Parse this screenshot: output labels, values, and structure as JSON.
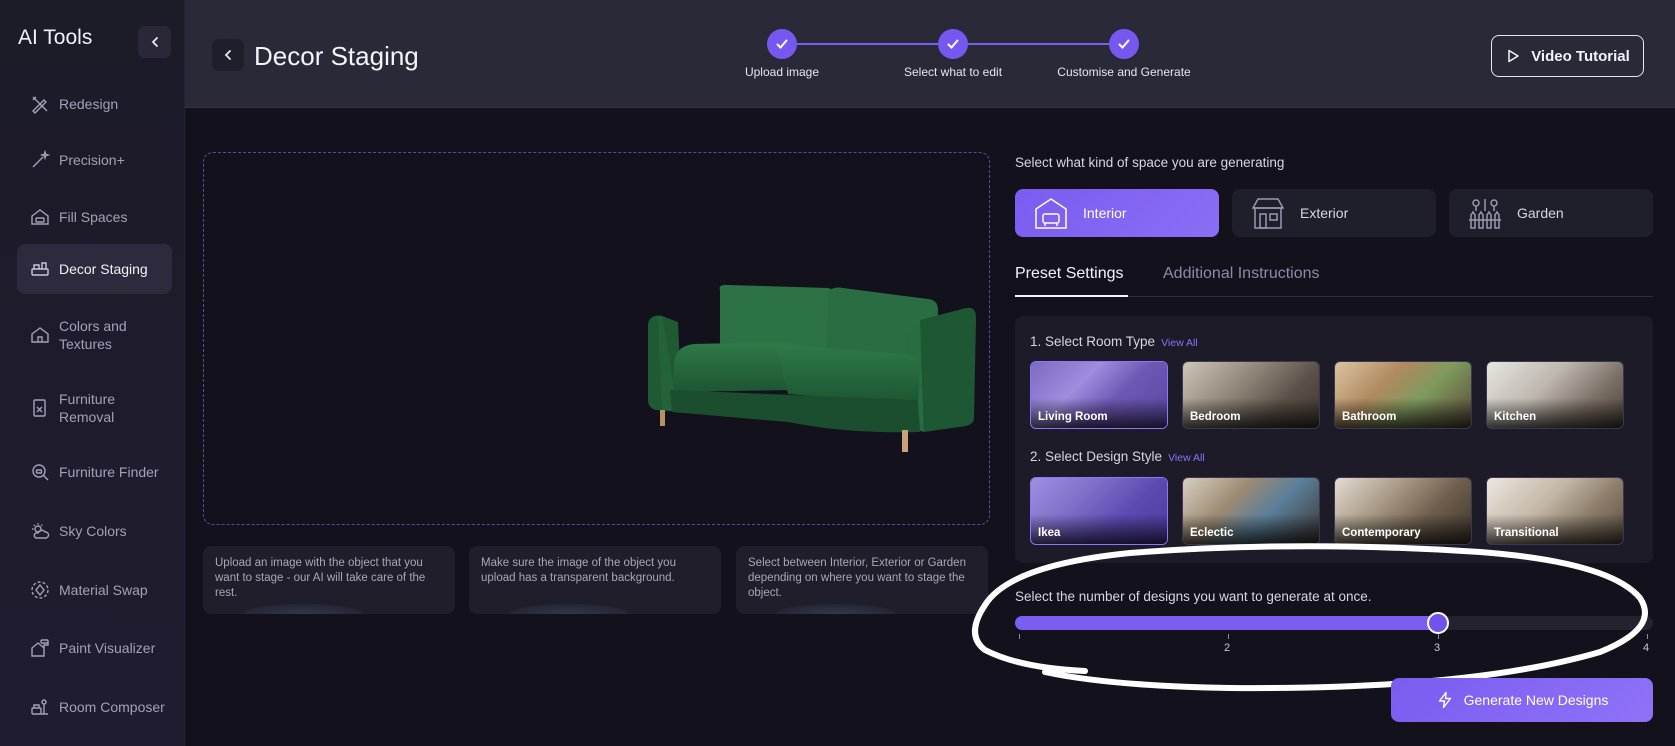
{
  "sidebar": {
    "title": "AI Tools",
    "items": [
      {
        "label": "Redesign",
        "icon": "pencil-ruler-icon"
      },
      {
        "label": "Precision+",
        "icon": "magic-wand-icon"
      },
      {
        "label": "Fill Spaces",
        "icon": "house-sofa-icon"
      },
      {
        "label": "Decor Staging",
        "icon": "staging-icon",
        "active": true
      },
      {
        "label": "Colors and Textures",
        "icon": "house-paint-icon"
      },
      {
        "label": "Furniture Removal",
        "icon": "removal-icon"
      },
      {
        "label": "Furniture Finder",
        "icon": "search-furniture-icon"
      },
      {
        "label": "Sky Colors",
        "icon": "sun-cloud-icon"
      },
      {
        "label": "Material Swap",
        "icon": "swap-circle-icon"
      },
      {
        "label": "Paint Visualizer",
        "icon": "paint-roller-icon"
      },
      {
        "label": "Room Composer",
        "icon": "composer-icon"
      }
    ]
  },
  "header": {
    "title": "Decor Staging",
    "steps": [
      {
        "label": "Upload image",
        "done": true
      },
      {
        "label": "Select what to edit",
        "done": true
      },
      {
        "label": "Customise and Generate",
        "done": true
      }
    ],
    "tutorial_label": "Video Tutorial"
  },
  "tips": [
    "Upload an image with the object that you want to stage - our AI will take care of the rest.",
    "Make sure the image of the object you upload has a transparent background.",
    "Select between Interior, Exterior or Garden depending on where you want to stage the object."
  ],
  "space": {
    "label": "Select what kind of space you are generating",
    "options": [
      {
        "label": "Interior",
        "selected": true
      },
      {
        "label": "Exterior",
        "selected": false
      },
      {
        "label": "Garden",
        "selected": false
      }
    ]
  },
  "tabs": [
    {
      "label": "Preset Settings",
      "active": true
    },
    {
      "label": "Additional Instructions",
      "active": false
    }
  ],
  "room_type": {
    "title": "1. Select Room Type",
    "view_all": "View All",
    "options": [
      {
        "label": "Living Room",
        "selected": true
      },
      {
        "label": "Bedroom",
        "selected": false
      },
      {
        "label": "Bathroom",
        "selected": false
      },
      {
        "label": "Kitchen",
        "selected": false
      }
    ]
  },
  "design_style": {
    "title": "2. Select Design Style",
    "view_all": "View All",
    "options": [
      {
        "label": "Ikea",
        "selected": true
      },
      {
        "label": "Eclectic",
        "selected": false
      },
      {
        "label": "Contemporary",
        "selected": false
      },
      {
        "label": "Transitional",
        "selected": false
      }
    ]
  },
  "designs_count": {
    "label": "Select the number of designs you want to generate at once.",
    "min": 1,
    "max": 4,
    "value": 3,
    "tick_labels": [
      "2",
      "3",
      "4"
    ]
  },
  "generate_label": "Generate New Designs",
  "colors": {
    "accent": "#7b5ef0",
    "background": "#13121c",
    "header": "#2a2937"
  }
}
